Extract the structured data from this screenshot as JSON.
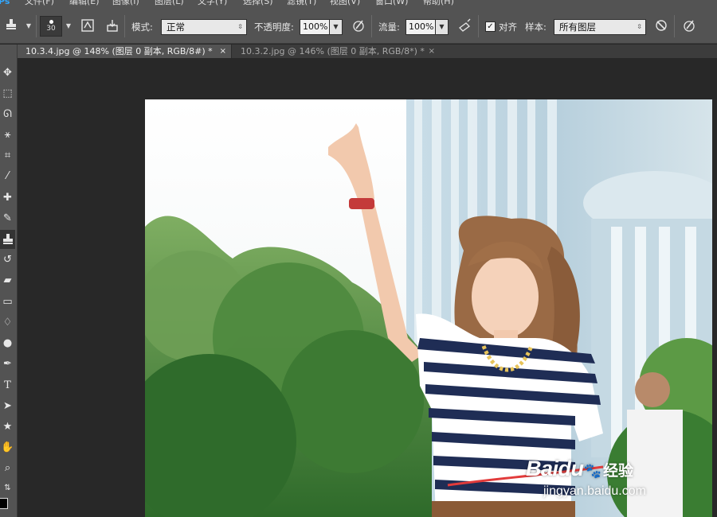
{
  "menu": {
    "items": [
      {
        "label": "文件(F)"
      },
      {
        "label": "编辑(E)"
      },
      {
        "label": "图像(I)"
      },
      {
        "label": "图层(L)"
      },
      {
        "label": "文字(Y)"
      },
      {
        "label": "选择(S)"
      },
      {
        "label": "滤镜(T)"
      },
      {
        "label": "视图(V)"
      },
      {
        "label": "窗口(W)"
      },
      {
        "label": "帮助(H)"
      }
    ]
  },
  "options": {
    "brush_size": "30",
    "mode_label": "模式:",
    "mode_value": "正常",
    "opacity_label": "不透明度:",
    "opacity_value": "100%",
    "flow_label": "流量:",
    "flow_value": "100%",
    "aligned_label": "对齐",
    "aligned_checked": true,
    "sample_label": "样本:",
    "sample_value": "所有图层"
  },
  "toolbar": {
    "tools": [
      "move-tool",
      "marquee-tool",
      "lasso-tool",
      "magic-wand-tool",
      "crop-tool",
      "eyedropper-tool",
      "healing-brush-tool",
      "brush-tool",
      "clone-stamp-tool",
      "history-brush-tool",
      "eraser-tool",
      "gradient-tool",
      "blur-tool",
      "dodge-tool",
      "pen-tool",
      "type-tool",
      "path-selection-tool",
      "shape-tool",
      "hand-tool",
      "zoom-tool",
      "swap-colors-icon"
    ],
    "active_tool": "clone-stamp-tool",
    "foreground_color": "#000000"
  },
  "tabs": [
    {
      "title": "10.3.4.jpg @ 148% (图层 0  副本, RGB/8#) *",
      "close": "×",
      "active": true
    },
    {
      "title": "10.3.2.jpg @ 146% (图层 0 副本, RGB/8*) *",
      "close": "×",
      "active": false
    }
  ],
  "watermark": {
    "brand": "Baidu",
    "brand_cn": "经验",
    "url": "jingyan.baidu.com"
  },
  "colors": {
    "chrome": "#535353",
    "workspace": "#282828",
    "tabbar": "#3c3c3c",
    "accent": "#31a8ff"
  }
}
